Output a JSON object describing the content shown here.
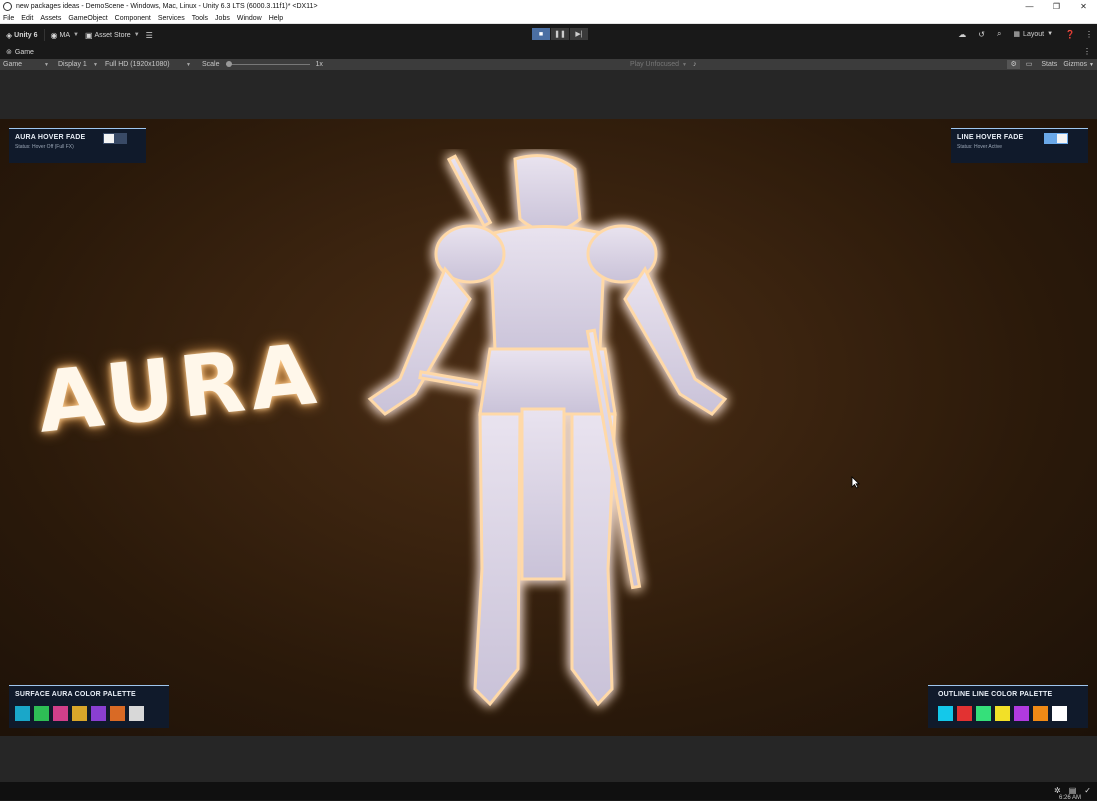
{
  "window": {
    "title": "new packages ideas - DemoScene - Windows, Mac, Linux - Unity 6.3 LTS (6000.3.11f1)* <DX11>",
    "minimize": "—",
    "maximize": "❐",
    "close": "✕"
  },
  "menu": [
    "File",
    "Edit",
    "Assets",
    "GameObject",
    "Component",
    "Services",
    "Tools",
    "Jobs",
    "Window",
    "Help"
  ],
  "toolbar": {
    "unity_label": "Unity 6",
    "account_label": "MA",
    "asset_store_label": "Asset Store",
    "layout_label": "Layout",
    "play_state": "playing"
  },
  "tab": {
    "label": "Game"
  },
  "gamebar": {
    "view_dropdown": "Game",
    "display_dropdown": "Display 1",
    "resolution_dropdown": "Full HD (1920x1080)",
    "scale_label": "Scale",
    "scale_value": "1x",
    "scale_fraction": 0,
    "play_focus": "Play Unfocused",
    "stats_label": "Stats",
    "gizmos_label": "Gizmos"
  },
  "scene": {
    "aura_word": "AURA"
  },
  "panels": {
    "aura_fade": {
      "title": "AURA HOVER FADE",
      "status": "Status: Hover Off (Full FX)",
      "toggle_on": false
    },
    "line_fade": {
      "title": "LINE HOVER FADE",
      "status": "Status: Hover Active",
      "toggle_on": true
    },
    "surface_palette": {
      "title": "SURFACE AURA COLOR PALETTE",
      "colors": [
        "#1aa7c9",
        "#2ebe55",
        "#d13f8a",
        "#d8a62a",
        "#8a3fd1",
        "#d96a25",
        "#d8d8d8"
      ]
    },
    "outline_palette": {
      "title": "OUTLINE LINE COLOR PALETTE",
      "colors": [
        "#14c8ea",
        "#e23232",
        "#35e07a",
        "#f2e028",
        "#b13ae0",
        "#f08a16",
        "#ffffff"
      ]
    }
  },
  "taskbar": {
    "clock": "6:26 AM"
  },
  "colors": {
    "accent": "#4b6fa3",
    "panel_bg": "#101a2b",
    "panel_border": "#9fc6ee",
    "aura_glow": "#ffb15a"
  }
}
